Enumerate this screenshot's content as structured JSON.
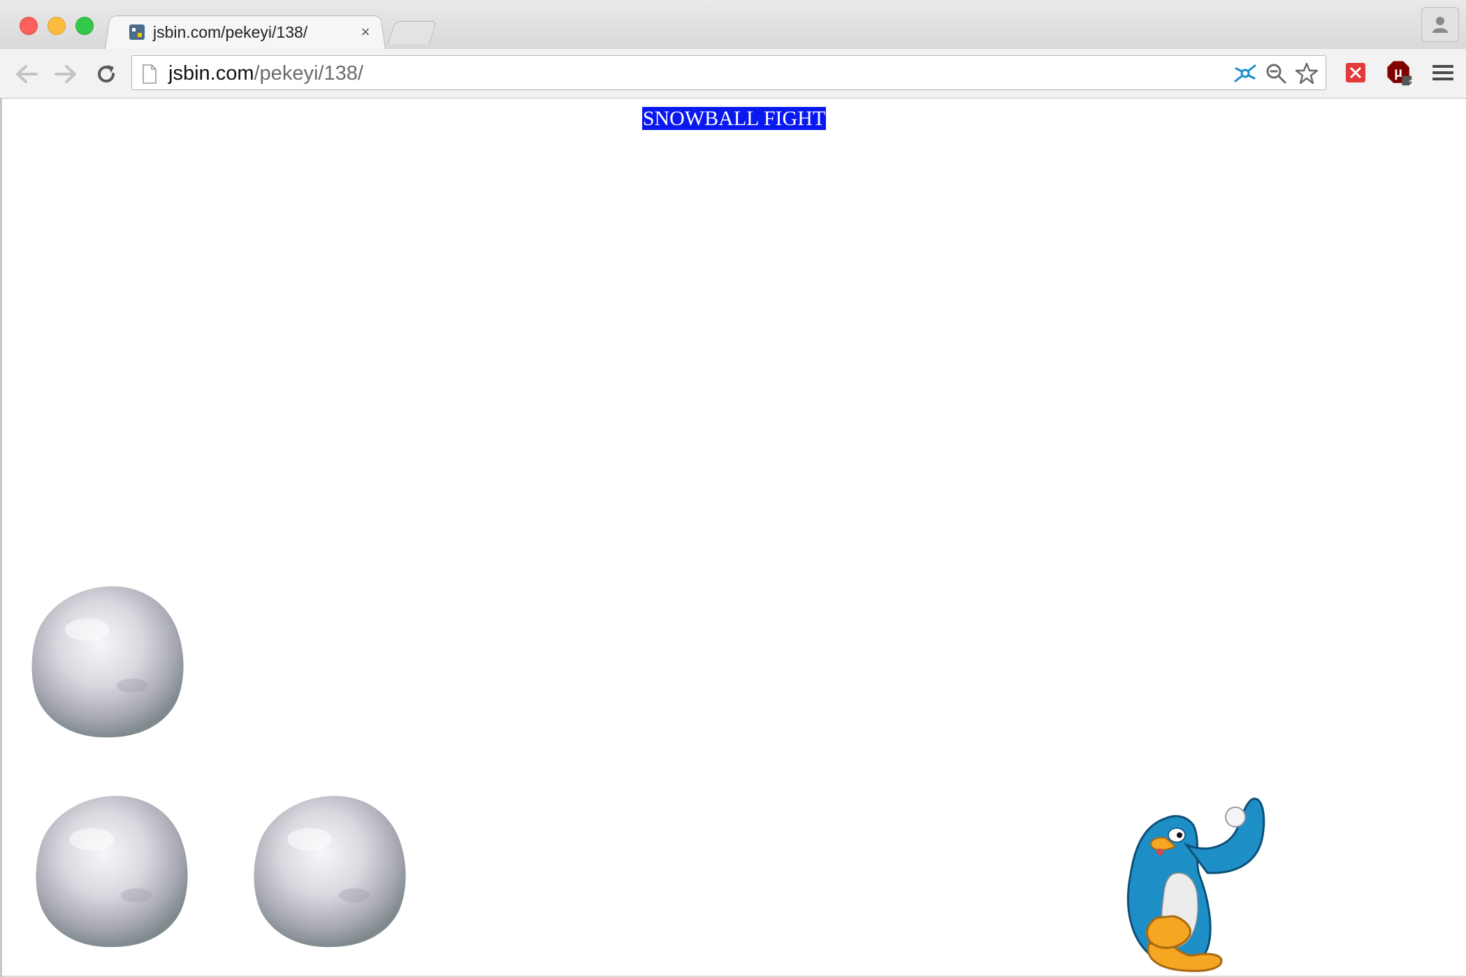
{
  "browser": {
    "tab": {
      "title": "jsbin.com/pekeyi/138/",
      "close_glyph": "×"
    },
    "address_bar": {
      "host": "jsbin.com",
      "path": "/pekeyi/138/"
    },
    "extension_badge": "2"
  },
  "page": {
    "title": "SNOWBALL FIGHT",
    "title_background": "#0a18f0",
    "title_color": "#ffffff"
  },
  "game": {
    "snowballs": [
      {
        "name": "snowball-1"
      },
      {
        "name": "snowball-2"
      },
      {
        "name": "snowball-3"
      }
    ],
    "player": {
      "character": "blue-penguin",
      "holding": "snowball"
    }
  }
}
